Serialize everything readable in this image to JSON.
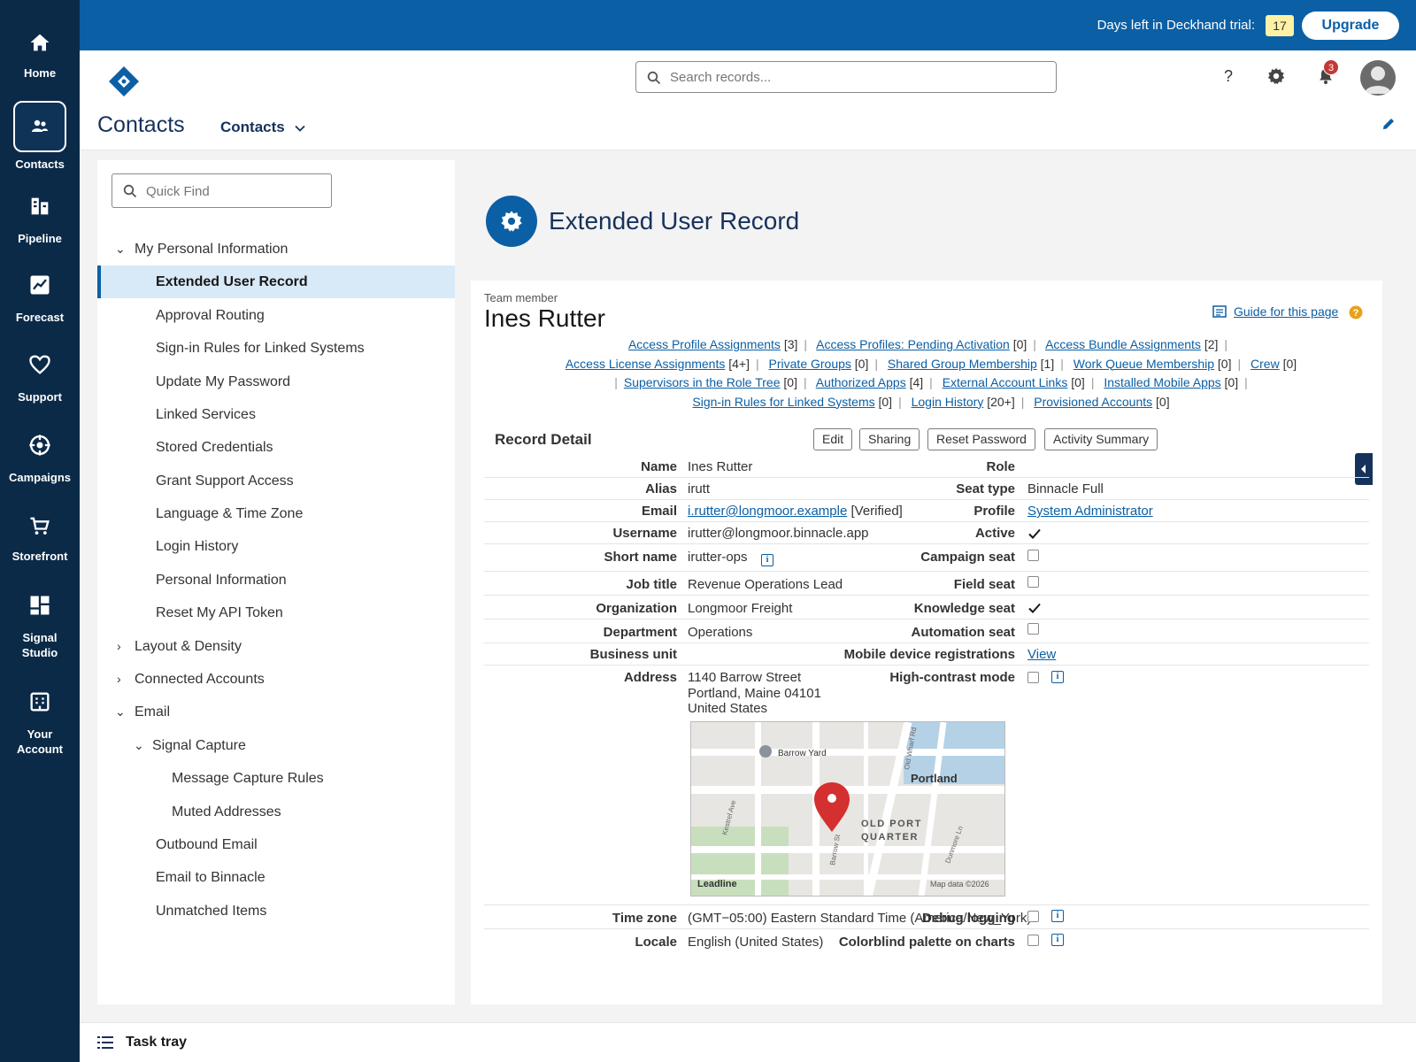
{
  "rail": {
    "items": [
      {
        "label": "Home",
        "icon": "home-icon"
      },
      {
        "label": "Contacts",
        "icon": "contacts-icon"
      },
      {
        "label": "Pipeline",
        "icon": "pipeline-icon"
      },
      {
        "label": "Forecast",
        "icon": "forecast-icon"
      },
      {
        "label": "Support",
        "icon": "heart-icon"
      },
      {
        "label": "Campaigns",
        "icon": "target-icon"
      },
      {
        "label": "Storefront",
        "icon": "cart-icon"
      },
      {
        "label": "Signal\nStudio",
        "icon": "dashboard-icon"
      },
      {
        "label": "Your\nAccount",
        "icon": "building-icon"
      }
    ]
  },
  "banner": {
    "trial_text": "Days left in Deckhand trial:",
    "trial_days": "17",
    "upgrade": "Upgrade"
  },
  "header": {
    "search_placeholder": "Search records...",
    "notification_count": "3",
    "app_title": "Contacts",
    "app_menu": "Contacts"
  },
  "setup": {
    "quick_find_placeholder": "Quick Find",
    "tree": [
      {
        "label": "My Personal Information",
        "chev": "down",
        "level": 0
      },
      {
        "label": "Extended User Record",
        "level": 1,
        "selected": true
      },
      {
        "label": "Approval Routing",
        "level": 1
      },
      {
        "label": "Sign-in Rules for Linked Systems",
        "level": 1
      },
      {
        "label": "Update My Password",
        "level": 1
      },
      {
        "label": "Linked Services",
        "level": 1
      },
      {
        "label": "Stored Credentials",
        "level": 1
      },
      {
        "label": "Grant Support Access",
        "level": 1
      },
      {
        "label": "Language & Time Zone",
        "level": 1
      },
      {
        "label": "Login History",
        "level": 1
      },
      {
        "label": "Personal Information",
        "level": 1
      },
      {
        "label": "Reset My API Token",
        "level": 1
      },
      {
        "label": "Layout & Density",
        "chev": "right",
        "level": 0
      },
      {
        "label": "Connected Accounts",
        "chev": "right",
        "level": 0
      },
      {
        "label": "Email",
        "chev": "down",
        "level": 0
      },
      {
        "label": "Signal Capture",
        "chev": "down",
        "level": 1
      },
      {
        "label": "Message Capture Rules",
        "level": 2
      },
      {
        "label": "Muted Addresses",
        "level": 2
      },
      {
        "label": "Outbound Email",
        "level": 1
      },
      {
        "label": "Email to Binnacle",
        "level": 1
      },
      {
        "label": "Unmatched Items",
        "level": 1
      }
    ]
  },
  "page": {
    "title": "Extended User Record"
  },
  "record": {
    "team_label": "Team member",
    "name": "Ines Rutter",
    "guide": "Guide for this page",
    "related_lines": [
      [
        {
          "link": "Access Profile Assignments",
          "count": "[3]"
        },
        {
          "link": "Access Profiles: Pending Activation",
          "count": "[0]"
        },
        {
          "link": "Access Bundle Assignments",
          "count": "[2]"
        }
      ],
      [
        {
          "link": "Access License Assignments",
          "count": "[4+]"
        },
        {
          "link": "Private Groups",
          "count": "[0]"
        },
        {
          "link": "Shared Group Membership",
          "count": "[1]"
        },
        {
          "link": "Work Queue Membership",
          "count": "[0]"
        },
        {
          "link": "Crew",
          "count": "[0]"
        }
      ],
      [
        {
          "link": "Supervisors in the Role Tree",
          "count": "[0]"
        },
        {
          "link": "Authorized Apps",
          "count": "[4]"
        },
        {
          "link": "External Account Links",
          "count": "[0]"
        },
        {
          "link": "Installed Mobile Apps",
          "count": "[0]"
        }
      ],
      [
        {
          "link": "Sign-in Rules for Linked Systems",
          "count": "[0]"
        },
        {
          "link": "Login History",
          "count": "[20+]"
        },
        {
          "link": "Provisioned Accounts",
          "count": "[0]"
        }
      ]
    ],
    "section_title": "Record Detail",
    "buttons": [
      "Edit",
      "Sharing",
      "Reset Password",
      "Activity Summary"
    ],
    "fields": {
      "name": {
        "label": "Name",
        "value": "Ines Rutter"
      },
      "role": {
        "label": "Role",
        "value": ""
      },
      "alias": {
        "label": "Alias",
        "value": "irutt"
      },
      "seat_type": {
        "label": "Seat type",
        "value": "Binnacle Full"
      },
      "email": {
        "label": "Email",
        "value": "i.rutter@longmoor.example",
        "suffix": "[Verified]"
      },
      "profile": {
        "label": "Profile",
        "value": "System Administrator"
      },
      "username": {
        "label": "Username",
        "value": "irutter@longmoor.binnacle.app"
      },
      "active": {
        "label": "Active",
        "checked": true
      },
      "short_name": {
        "label": "Short name",
        "value": "irutter-ops"
      },
      "campaign_seat": {
        "label": "Campaign seat",
        "checked": false
      },
      "job_title": {
        "label": "Job title",
        "value": "Revenue Operations Lead"
      },
      "field_seat": {
        "label": "Field seat",
        "checked": false
      },
      "organization": {
        "label": "Organization",
        "value": "Longmoor Freight"
      },
      "knowledge_seat": {
        "label": "Knowledge seat",
        "checked": true
      },
      "department": {
        "label": "Department",
        "value": "Operations"
      },
      "automation_seat": {
        "label": "Automation seat",
        "checked": false
      },
      "business_unit": {
        "label": "Business unit",
        "value": ""
      },
      "mobile_reg": {
        "label": "Mobile device registrations",
        "value": "View"
      },
      "address": {
        "label": "Address",
        "line1": "1140 Barrow Street",
        "line2": "Portland, Maine 04101",
        "line3": "United States"
      },
      "high_contrast": {
        "label": "High-contrast mode",
        "checked": false
      },
      "time_zone": {
        "label": "Time zone",
        "value": "(GMT−05:00) Eastern Standard Time (America/New_York)"
      },
      "debug_logging": {
        "label": "Debug logging",
        "checked": false
      },
      "locale": {
        "label": "Locale",
        "value": "English (United States)"
      },
      "colorblind": {
        "label": "Colorblind palette on charts",
        "checked": false
      }
    },
    "map": {
      "labels": {
        "barrow_yard": "Barrow Yard",
        "portland": "Portland",
        "old_port": "OLD PORT",
        "quarter": "QUARTER",
        "kestrel": "Kestrel Ave",
        "barrow_st": "Barrow St",
        "old_wharf": "Old Wharf Rd",
        "dunmore": "Dunmore Ln",
        "brand": "Leadline",
        "attribution": "Map data ©2026"
      }
    }
  },
  "task_tray": {
    "label": "Task tray"
  },
  "colors": {
    "brand_blue": "#0b5fa5",
    "rail_navy": "#0b2a48",
    "selected_bg": "#d8e9f7",
    "pin_red": "#d3302f"
  }
}
